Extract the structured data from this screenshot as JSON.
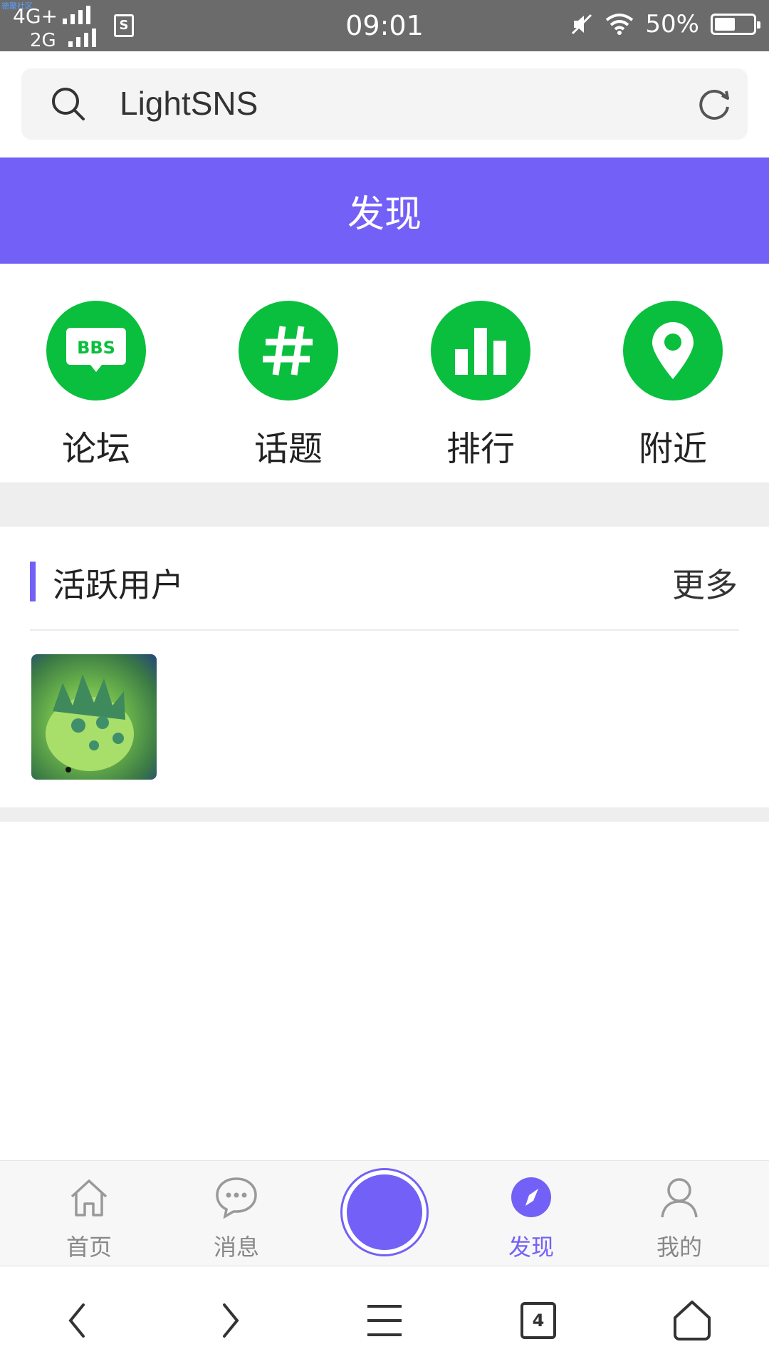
{
  "status_bar": {
    "carrier_tiny": "德聚社区",
    "net1": "4G+",
    "net2": "2G",
    "sim_badge": "S",
    "time": "09:01",
    "battery": "50%"
  },
  "search": {
    "text": "LightSNS"
  },
  "header": {
    "title": "发现"
  },
  "quick_menu": [
    {
      "label": "论坛",
      "icon": "bbs-icon",
      "icon_text": "BBS"
    },
    {
      "label": "话题",
      "icon": "hashtag-icon"
    },
    {
      "label": "排行",
      "icon": "bar-chart-icon"
    },
    {
      "label": "附近",
      "icon": "location-pin-icon"
    }
  ],
  "active_users": {
    "title": "活跃用户",
    "more": "更多"
  },
  "tabbar": {
    "items": [
      {
        "label": "首页",
        "icon": "home-icon"
      },
      {
        "label": "消息",
        "icon": "chat-bubble-icon"
      },
      {
        "label": "发现",
        "icon": "compass-icon",
        "active": true
      },
      {
        "label": "我的",
        "icon": "user-icon"
      }
    ]
  },
  "system_nav": {
    "tab_count": "4"
  },
  "colors": {
    "accent": "#7360f6",
    "green": "#09bf3d"
  }
}
